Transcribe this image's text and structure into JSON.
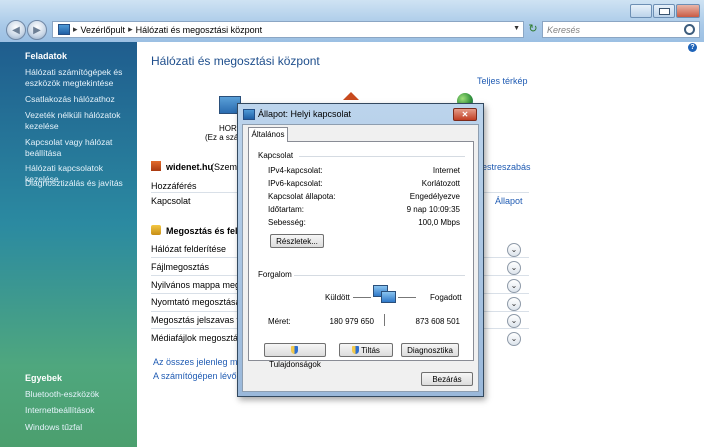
{
  "breadcrumb": {
    "part1": "Vezérlőpult",
    "part2": "Hálózati és megosztási központ",
    "search_placeholder": "Keresés"
  },
  "sidebar": {
    "tasks_header": "Feladatok",
    "tasks": [
      "Hálózati számítógépek és eszközök megtekintése",
      "Csatlakozás hálózathoz",
      "Vezeték nélküli hálózatok kezelése",
      "Kapcsolat vagy hálózat beállítása",
      "Hálózati kapcsolatok kezelése",
      "Diagnosztizálás és javítás"
    ],
    "other_header": "Egyebek",
    "other": [
      "Bluetooth-eszközök",
      "Internetbeállítások",
      "Windows tűzfal"
    ]
  },
  "main": {
    "title": "Hálózati és megosztási központ",
    "full_map": "Teljes térkép",
    "map_node_name": "HORI",
    "map_node_sub": "(Ez a szám",
    "network_name": "widenet.hu",
    "network_suffix": "(Szemé",
    "customize": "estreszabás",
    "access_label": "Hozzáférés",
    "connection_label": "Kapcsolat",
    "status_link": "Állapot",
    "sharing_header": "Megosztás és felde",
    "sharing_rows": [
      "Hálózat felderítése",
      "Fájlmegosztás",
      "Nyilvános mappa megos",
      "Nyomtató megosztása",
      "Megosztás jelszavas véd",
      "Médiafájlok megosztása"
    ],
    "bottom_links": [
      "Az összes jelenleg megi",
      "A számítógépen lévő összes me"
    ]
  },
  "dialog": {
    "title": "Állapot: Helyi kapcsolat",
    "tab": "Általános",
    "connection_group": "Kapcsolat",
    "fields": [
      {
        "label": "IPv4-kapcsolat:",
        "value": "Internet"
      },
      {
        "label": "IPv6-kapcsolat:",
        "value": "Korlátozott"
      },
      {
        "label": "Kapcsolat állapota:",
        "value": "Engedélyezve"
      },
      {
        "label": "Időtartam:",
        "value": "9 nap 10:09:35"
      },
      {
        "label": "Sebesség:",
        "value": "100,0 Mbps"
      }
    ],
    "details_button": "Részletek...",
    "activity_group": "Forgalom",
    "sent_label": "Küldött",
    "received_label": "Fogadott",
    "size_label": "Méret:",
    "sent_value": "180 979 650",
    "received_value": "873 608 501",
    "properties_button": "Tulajdonságok",
    "disable_button": "Tiltás",
    "diagnose_button": "Diagnosztika",
    "close_button": "Bezárás"
  }
}
